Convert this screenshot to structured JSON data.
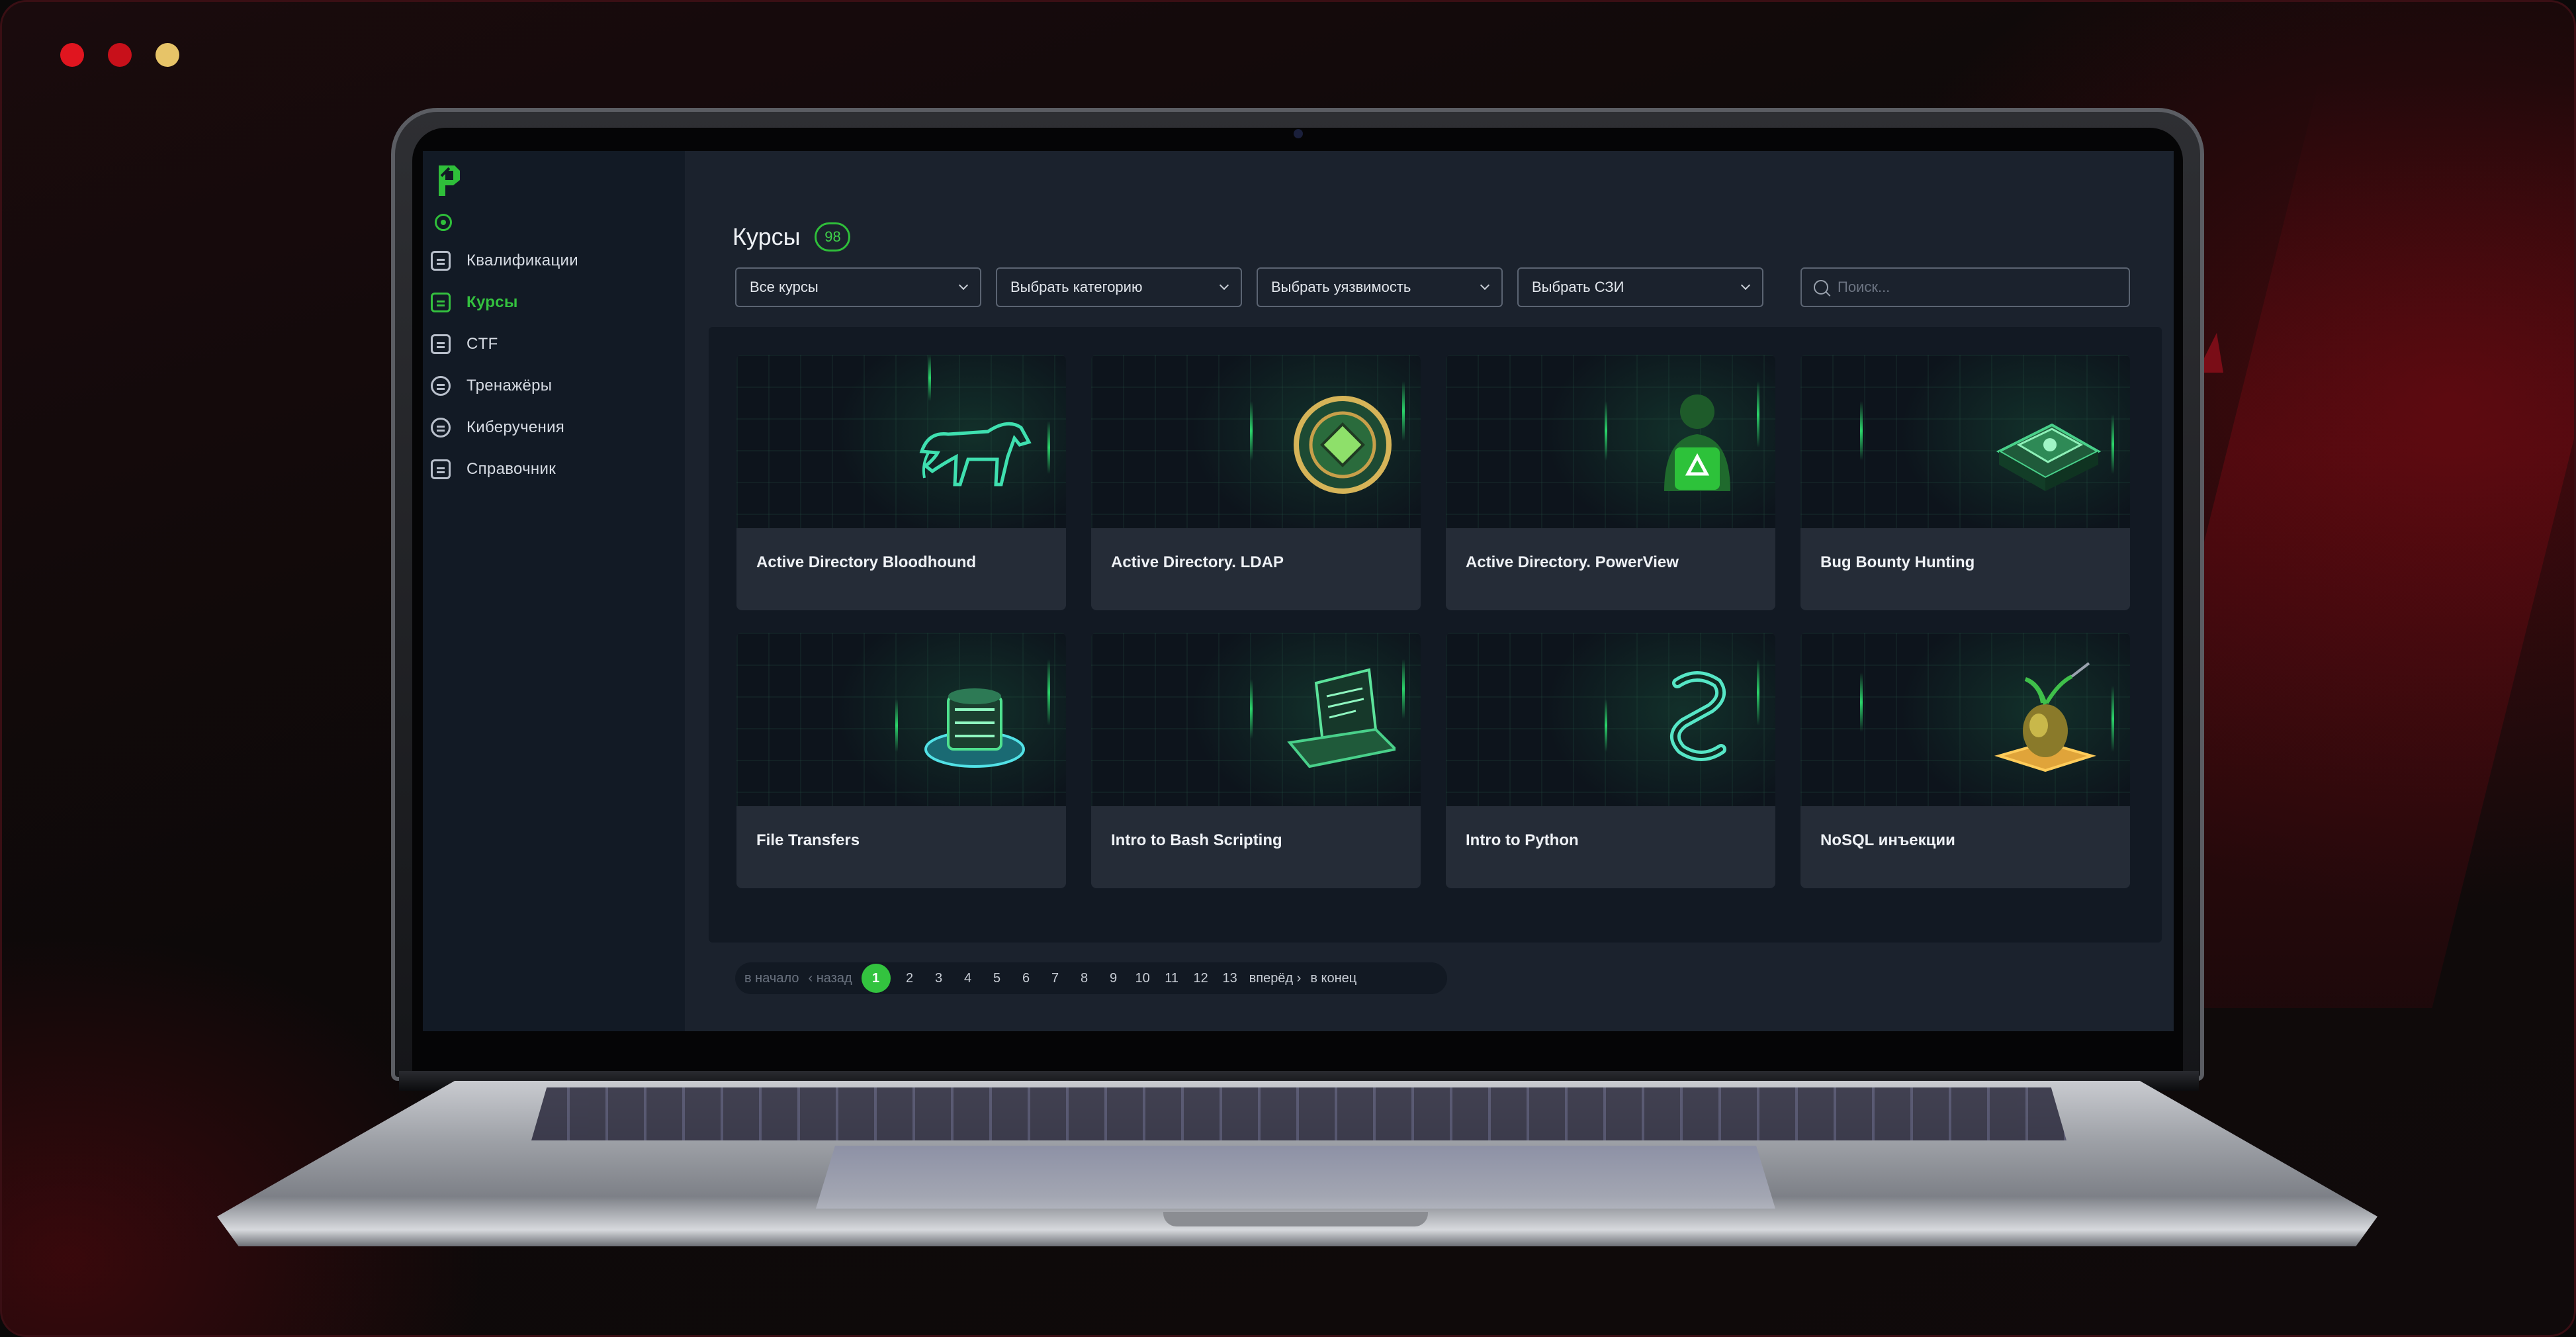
{
  "sidebar": {
    "items": [
      {
        "label": "Квалификации",
        "icon": "chart-icon",
        "active": false
      },
      {
        "label": "Курсы",
        "icon": "courses-icon",
        "active": true
      },
      {
        "label": "CTF",
        "icon": "flag-icon",
        "active": false
      },
      {
        "label": "Тренажёры",
        "icon": "shield-icon",
        "active": false
      },
      {
        "label": "Киберучения",
        "icon": "target-icon",
        "active": false
      },
      {
        "label": "Справочник",
        "icon": "book-icon",
        "active": false
      }
    ]
  },
  "header": {
    "title": "Курсы",
    "count": "98"
  },
  "filters": {
    "all_courses": "Все курсы",
    "category": "Выбрать категорию",
    "vulnerability": "Выбрать уязвимость",
    "szi": "Выбрать СЗИ"
  },
  "search": {
    "placeholder": "Поиск..."
  },
  "cards": [
    {
      "title": "Active Directory Bloodhound",
      "art": "hound-icon"
    },
    {
      "title": "Active Directory. LDAP",
      "art": "badge-icon"
    },
    {
      "title": "Active Directory. PowerView",
      "art": "hacker-icon"
    },
    {
      "title": "Bug Bounty Hunting",
      "art": "chip-icon"
    },
    {
      "title": "File Transfers",
      "art": "server-icon"
    },
    {
      "title": "Intro to Bash Scripting",
      "art": "laptop-icon"
    },
    {
      "title": "Intro to Python",
      "art": "python-icon"
    },
    {
      "title": "NoSQL инъекции",
      "art": "mango-icon"
    }
  ],
  "pagination": {
    "first": "в начало",
    "prev": "‹ назад",
    "current": "1",
    "pages": [
      "2",
      "3",
      "4",
      "5",
      "6",
      "7",
      "8",
      "9",
      "10",
      "11",
      "12",
      "13"
    ],
    "next": "вперёд ›",
    "last": "в конец"
  },
  "colors": {
    "accent": "#34c13f",
    "background": "#1b222d",
    "sidebar": "#121a25"
  }
}
